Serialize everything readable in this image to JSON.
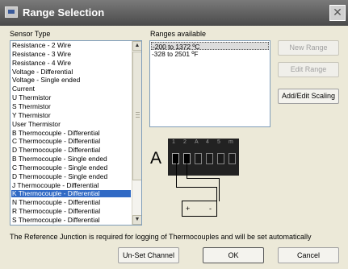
{
  "window": {
    "title": "Range Selection",
    "close_glyph": "✕"
  },
  "sensor": {
    "label": "Sensor Type",
    "items": [
      "Resistance - 2 Wire",
      "Resistance - 3 Wire",
      "Resistance - 4 Wire",
      "Voltage - Differential",
      "Voltage - Single ended",
      "Current",
      "U  Thermistor",
      "S  Thermistor",
      "Y  Thermistor",
      "User Thermistor",
      "B Thermocouple - Differential",
      "C Thermocouple - Differential",
      "D Thermocouple - Differential",
      "B Thermocouple - Single ended",
      "C Thermocouple - Single ended",
      "D Thermocouple - Single ended",
      "J Thermocouple - Differential",
      "K Thermocouple - Differential",
      "N Thermocouple - Differential",
      "R Thermocouple - Differential",
      "S Thermocouple - Differential"
    ],
    "selected_item": "K Thermocouple - Differential",
    "scroll_up": "▲",
    "scroll_down": "▼"
  },
  "ranges": {
    "label": "Ranges available",
    "items": [
      "-200 to 1372 ºC",
      "-328 to 2501 ºF"
    ],
    "highlighted_item": "-200 to 1372 ºC"
  },
  "buttons": {
    "new_range": "New Range",
    "edit_range": "Edit Range",
    "add_edit_scaling": "Add/Edit Scaling",
    "unset_channel": "Un-Set Channel",
    "ok": "OK",
    "cancel": "Cancel"
  },
  "diagram": {
    "letter": "A",
    "terminal_labels": [
      "1",
      "2",
      "A",
      "4",
      "5",
      "m"
    ],
    "plus": "+",
    "minus": "-"
  },
  "footer_text": "The Reference Junction is required for logging of Thermocouples and will be set automatically",
  "colors": {
    "selection": "#316ac5",
    "title_bar": "#5a5a5a"
  }
}
